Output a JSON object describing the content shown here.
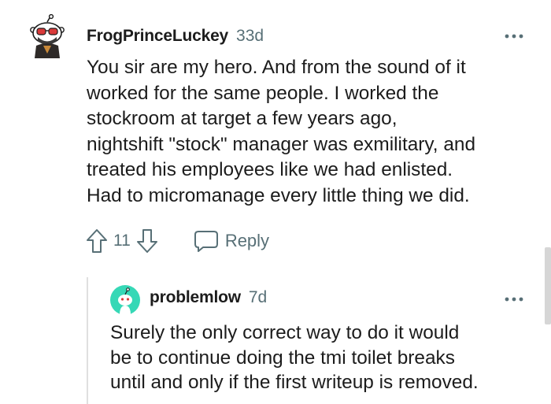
{
  "comment": {
    "username": "FrogPrinceLuckey",
    "age": "33d",
    "lines": [
      "You sir are my hero. And from the sound of it",
      "worked for the same people. I worked the",
      "stockroom at target a few years ago,",
      "nightshift \"stock\" manager was exmilitary, and",
      "treated his employees like we had enlisted.",
      "Had to micromanage every little thing we did."
    ],
    "score": "11",
    "reply_label": "Reply",
    "icons": {
      "avatar": "snoo-avatar-icon",
      "more": "more-options-icon",
      "upvote": "upvote-arrow-icon",
      "downvote": "downvote-arrow-icon",
      "reply": "speech-bubble-icon"
    }
  },
  "reply": {
    "username": "problemlow",
    "age": "7d",
    "lines": [
      "Surely the only correct way to do it would",
      "be to continue doing the tmi toilet breaks",
      "until and only if the first writeup is removed."
    ],
    "icons": {
      "avatar": "snoo-avatar-icon",
      "more": "more-options-icon"
    }
  },
  "colors": {
    "text": "#1c1c1c",
    "meta": "#576f76",
    "reply_avatar": "#36d8b6",
    "thread_line": "#e0e0e0"
  }
}
